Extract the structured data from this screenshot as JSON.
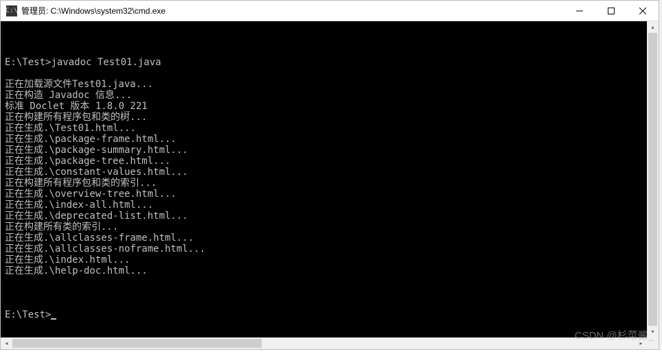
{
  "title": "管理员: C:\\Windows\\system32\\cmd.exe",
  "icon_label": "C:\\",
  "prompt1": "E:\\Test>",
  "command1": "javadoc Test01.java",
  "lines": [
    "正在加载源文件Test01.java...",
    "正在构造 Javadoc 信息...",
    "标准 Doclet 版本 1.8.0_221",
    "正在构建所有程序包和类的树...",
    "正在生成.\\Test01.html...",
    "正在生成.\\package-frame.html...",
    "正在生成.\\package-summary.html...",
    "正在生成.\\package-tree.html...",
    "正在生成.\\constant-values.html...",
    "正在构建所有程序包和类的索引...",
    "正在生成.\\overview-tree.html...",
    "正在生成.\\index-all.html...",
    "正在生成.\\deprecated-list.html...",
    "正在构建所有类的索引...",
    "正在生成.\\allclasses-frame.html...",
    "正在生成.\\allclasses-noframe.html...",
    "正在生成.\\index.html...",
    "正在生成.\\help-doc.html..."
  ],
  "prompt2": "E:\\Test>",
  "watermark": "CSDN @杉菜酱_"
}
